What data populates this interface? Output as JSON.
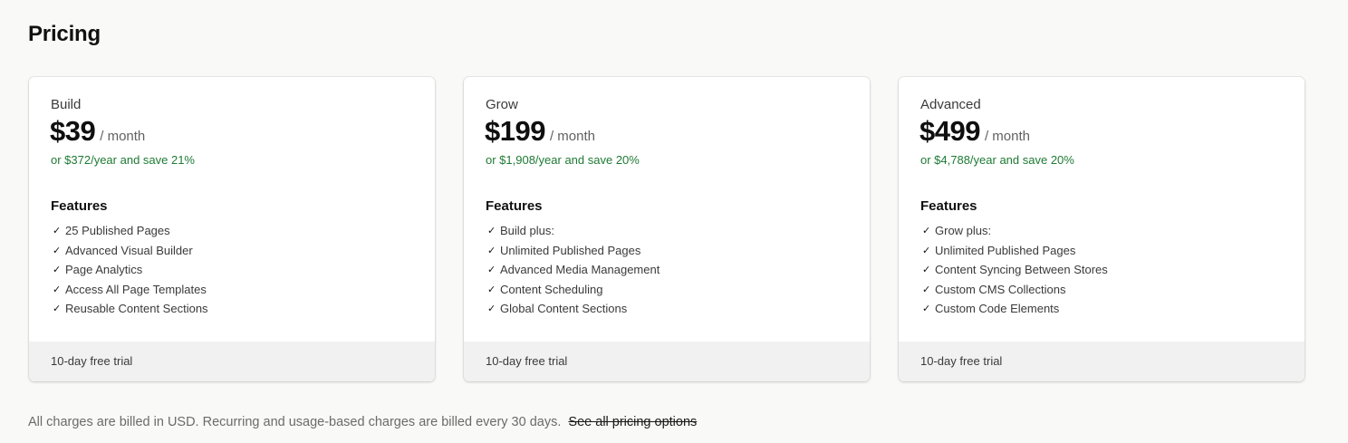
{
  "page": {
    "title": "Pricing"
  },
  "plans": [
    {
      "name": "Build",
      "price": "$39",
      "period": "/ month",
      "annual": "or $372/year and save 21%",
      "features_heading": "Features",
      "features": [
        "25 Published Pages",
        "Advanced Visual Builder",
        "Page Analytics",
        "Access All Page Templates",
        "Reusable Content Sections"
      ],
      "trial": "10-day free trial"
    },
    {
      "name": "Grow",
      "price": "$199",
      "period": "/ month",
      "annual": "or $1,908/year and save 20%",
      "features_heading": "Features",
      "features": [
        "Build plus:",
        "Unlimited Published Pages",
        "Advanced Media Management",
        "Content Scheduling",
        "Global Content Sections"
      ],
      "trial": "10-day free trial"
    },
    {
      "name": "Advanced",
      "price": "$499",
      "period": "/ month",
      "annual": "or $4,788/year and save 20%",
      "features_heading": "Features",
      "features": [
        "Grow plus:",
        "Unlimited Published Pages",
        "Content Syncing Between Stores",
        "Custom CMS Collections",
        "Custom Code Elements"
      ],
      "trial": "10-day free trial"
    }
  ],
  "footer": {
    "note": "All charges are billed in USD. Recurring and usage-based charges are billed every 30 days.",
    "link": "See all pricing options"
  },
  "icons": {
    "check": "check-icon"
  },
  "colors": {
    "background": "#f9f9f8",
    "card": "#ffffff",
    "card_footer": "#f1f1f1",
    "savings_green": "#1e7a34",
    "muted_text": "#6b6b6b"
  }
}
